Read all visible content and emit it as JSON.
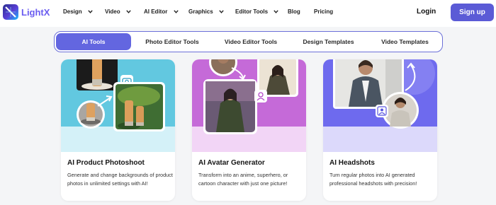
{
  "header": {
    "brand": "LightX",
    "nav": [
      {
        "label": "Design",
        "has_dropdown": true
      },
      {
        "label": "Video",
        "has_dropdown": true
      },
      {
        "label": "AI Editor",
        "has_dropdown": true
      },
      {
        "label": "Graphics",
        "has_dropdown": true
      },
      {
        "label": "Editor Tools",
        "has_dropdown": true
      },
      {
        "label": "Blog",
        "has_dropdown": false
      },
      {
        "label": "Pricing",
        "has_dropdown": false
      }
    ],
    "login_label": "Login",
    "signup_label": "Sign up"
  },
  "tabs": [
    {
      "label": "AI Tools",
      "active": true
    },
    {
      "label": "Photo Editor Tools",
      "active": false
    },
    {
      "label": "Video Editor Tools",
      "active": false
    },
    {
      "label": "Design Templates",
      "active": false
    },
    {
      "label": "Video Templates",
      "active": false
    }
  ],
  "cards": [
    {
      "title": "AI Product Photoshoot",
      "description": "Generate and change backgrounds of product photos in unlimited settings with AI!",
      "badge_icon": "camera-icon"
    },
    {
      "title": "AI Avatar Generator",
      "description": "Transform into an anime, superhero, or cartoon character with just one picture!",
      "badge_icon": "avatar-icon"
    },
    {
      "title": "AI Headshots",
      "description": "Turn regular photos into AI generated professional headshots with precision!",
      "badge_icon": "portrait-icon"
    }
  ],
  "colors": {
    "accent": "#6366e0",
    "brand": "#6a5cf0",
    "signup_bg": "#5b5bd6",
    "card1_bg": "#62c8e0",
    "card2_bg": "#c56ad8",
    "card3_bg": "#6e6aee"
  }
}
